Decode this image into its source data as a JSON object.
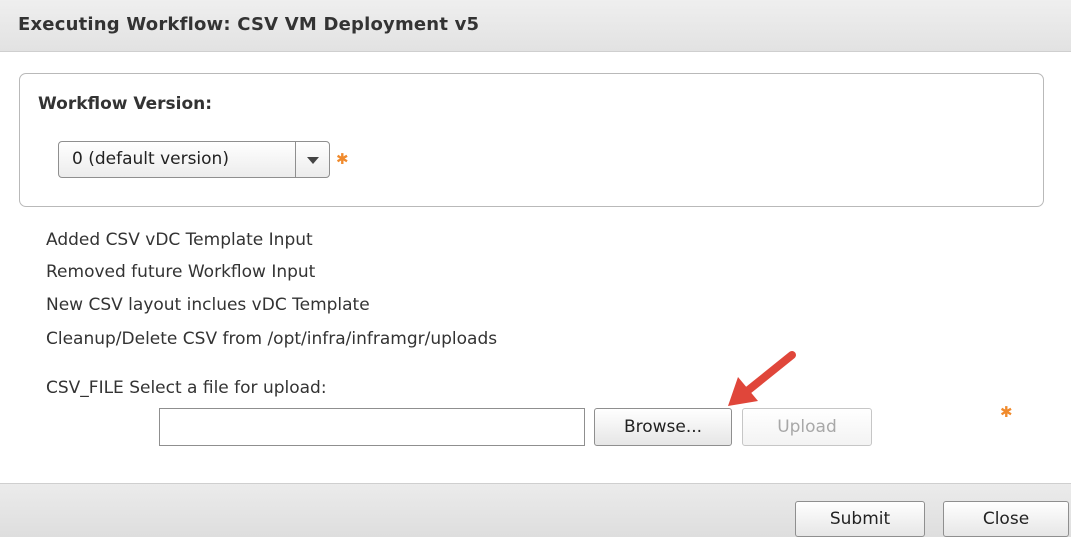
{
  "dialog": {
    "title": "Executing Workflow: CSV VM Deployment v5"
  },
  "workflow_version": {
    "label": "Workflow Version:",
    "selected": "0  (default version)",
    "required_mark": "✱"
  },
  "description_lines": [
    "Added CSV vDC Template Input",
    "Removed future Workflow Input",
    "New CSV layout inclues vDC Template",
    "Cleanup/Delete CSV from /opt/infra/inframgr/uploads"
  ],
  "csv_file": {
    "label": "CSV_FILE Select a file for upload:",
    "value": "",
    "browse_label": "Browse...",
    "upload_label": "Upload",
    "required_mark": "✱"
  },
  "footer": {
    "submit_label": "Submit",
    "close_label": "Close"
  },
  "colors": {
    "required": "#f08a2c",
    "annotation_arrow": "#e0463a"
  },
  "icons": {
    "dropdown": "chevron-down-icon",
    "required": "asterisk-icon",
    "annotation": "arrow-annotation-icon"
  }
}
